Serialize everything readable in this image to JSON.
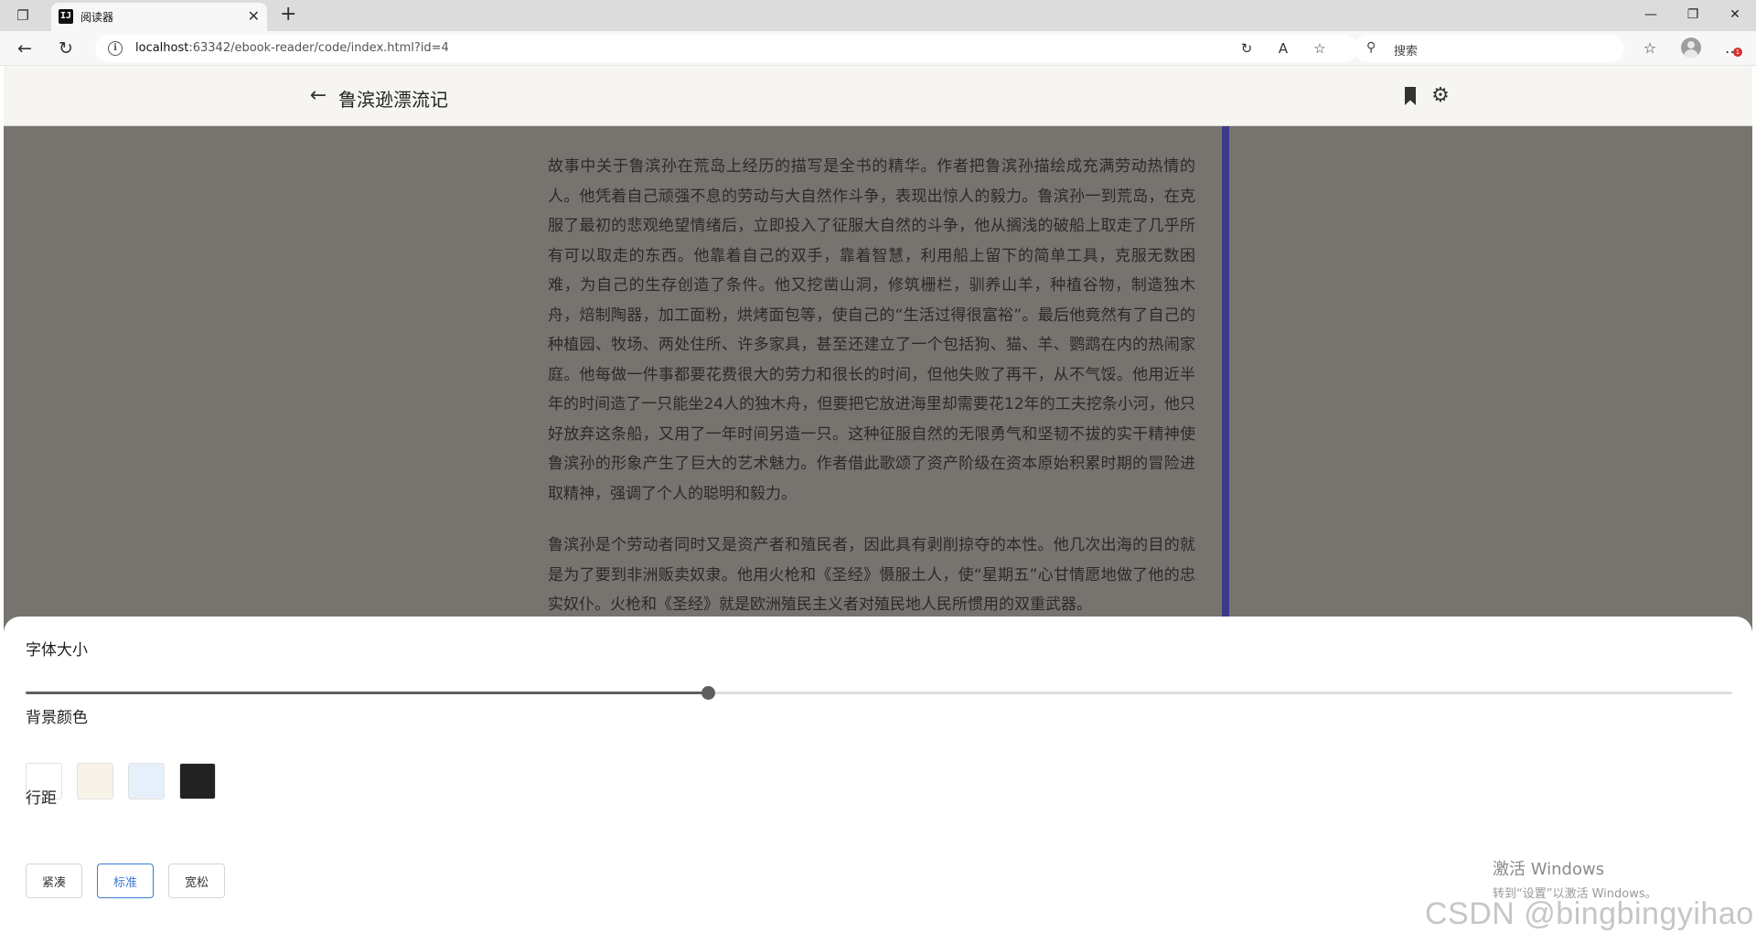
{
  "browser": {
    "tab": {
      "favicon_text": "IJ",
      "title": "阅读器",
      "close": "✕"
    },
    "new_tab": "+",
    "window": {
      "minimize": "—",
      "restore": "❐",
      "close": "✕"
    },
    "url_host": "localhost",
    "url_rest": ":63342/ebook-reader/code/index.html?id=4",
    "search_placeholder": "搜索",
    "icons": {
      "back": "←",
      "refresh": "↻",
      "info": "i",
      "translate": "↻",
      "read_aloud": "A",
      "favorite": "☆",
      "search": "⚲",
      "favorites_list": "☆",
      "menu": "…"
    },
    "menu_badge": "1"
  },
  "app": {
    "back": "←",
    "title": "鲁滨逊漂流记",
    "gear": "⚙",
    "content": [
      "故事中关于鲁滨孙在荒岛上经历的描写是全书的精华。作者把鲁滨孙描绘成充满劳动热情的人。他凭着自己顽强不息的劳动与大自然作斗争，表现出惊人的毅力。鲁滨孙一到荒岛，在克服了最初的悲观绝望情绪后，立即投入了征服大自然的斗争，他从搁浅的破船上取走了几乎所有可以取走的东西。他靠着自己的双手，靠着智慧，利用船上留下的简单工具，克服无数困难，为自己的生存创造了条件。他又挖凿山洞，修筑栅栏，驯养山羊，种植谷物，制造独木舟，焙制陶器，加工面粉，烘烤面包等，使自己的“生活过得很富裕”。最后他竟然有了自己的种植园、牧场、两处住所、许多家具，甚至还建立了一个包括狗、猫、羊、鹦鹉在内的热闹家庭。他每做一件事都要花费很大的劳力和很长的时间，但他失败了再干，从不气馁。他用近半年的时间造了一只能坐24人的独木舟，但要把它放进海里却需要花12年的工夫挖条小河，他只好放弃这条船，又用了一年时间另造一只。这种征服自然的无限勇气和坚韧不拔的实干精神使鲁滨孙的形象产生了巨大的艺术魅力。作者借此歌颂了资产阶级在资本原始积累时期的冒险进取精神，强调了个人的聪明和毅力。",
      "鲁滨孙是个劳动者同时又是资产者和殖民者，因此具有剥削掠夺的本性。他几次出海的目的就是为了要到非洲贩卖奴隶。他用火枪和《圣经》慑服土人，使“星期五”心甘情愿地做了他的忠实奴仆。火枪和《圣经》就是欧洲殖民主义者对殖民地人民所惯用的双重武器。"
    ],
    "scroll_position": 0.2
  },
  "settings": {
    "font_size_label": "字体大小",
    "font_size_level": 0.4,
    "bg_label": "背景颜色",
    "bg_colors": [
      "#ffffff",
      "#f7f3e8",
      "#e6f0fb",
      "#222222"
    ],
    "spacing_label": "行距",
    "spacing_options": [
      "紧凑",
      "标准",
      "宽松"
    ],
    "spacing_selected": 1
  },
  "overlay": {
    "activate_title": "激活 Windows",
    "activate_sub": "转到“设置”以激活 Windows。",
    "watermark": "CSDN @bingbingyihao"
  },
  "colors": {
    "reader_bg": "#77746f",
    "accent": "#3a7bd5",
    "scroll_indicator": "#3d3a87"
  }
}
